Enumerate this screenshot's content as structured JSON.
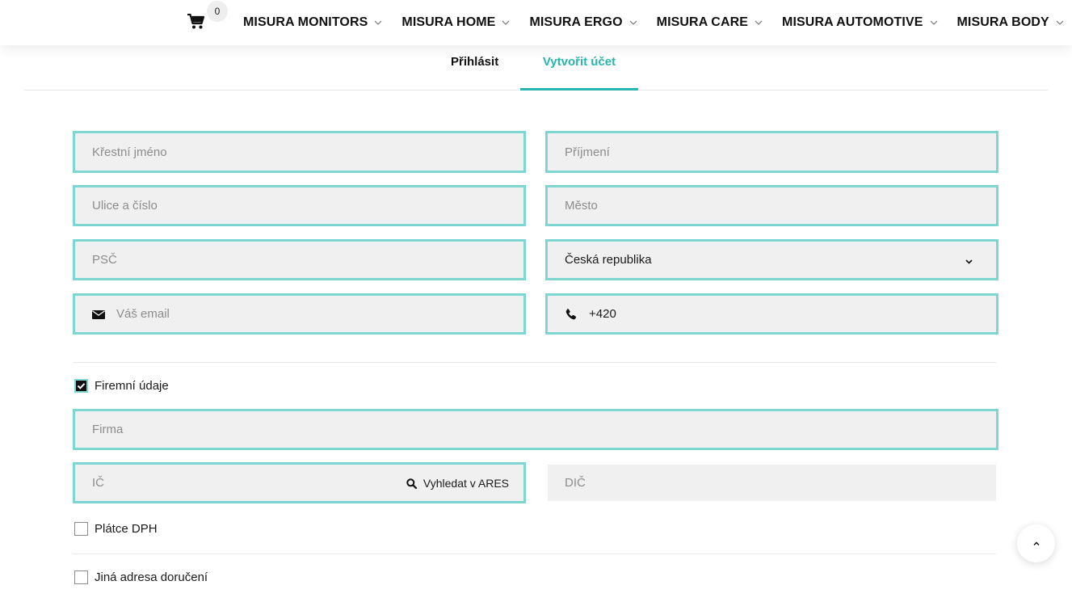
{
  "header": {
    "cart_count": "0",
    "nav": [
      {
        "label": "MISURA MONITORS"
      },
      {
        "label": "MISURA HOME"
      },
      {
        "label": "MISURA ERGO"
      },
      {
        "label": "MISURA CARE"
      },
      {
        "label": "MISURA AUTOMOTIVE"
      },
      {
        "label": "MISURA BODY"
      }
    ]
  },
  "tabs": {
    "login": "Přihlásit",
    "register": "Vytvořit účet",
    "active": "register"
  },
  "form": {
    "first_name": {
      "placeholder": "Křestní jméno",
      "value": ""
    },
    "last_name": {
      "placeholder": "Příjmení",
      "value": ""
    },
    "street": {
      "placeholder": "Ulice a číslo",
      "value": ""
    },
    "city": {
      "placeholder": "Město",
      "value": ""
    },
    "zip": {
      "placeholder": "PSČ",
      "value": ""
    },
    "country": {
      "selected": "Česká republika"
    },
    "email": {
      "placeholder": "Váš email",
      "value": ""
    },
    "phone": {
      "value": "+420"
    },
    "company_checkbox": {
      "label": "Firemní údaje",
      "checked": true
    },
    "company": {
      "placeholder": "Firma",
      "value": ""
    },
    "ic": {
      "placeholder": "IČ",
      "value": ""
    },
    "ares_button": {
      "label": "Vyhledat v ARES"
    },
    "dic": {
      "placeholder": "DIČ",
      "value": ""
    },
    "vat_payer": {
      "label": "Plátce DPH",
      "checked": false
    },
    "other_address": {
      "label": "Jiná adresa doručení",
      "checked": false
    }
  },
  "colors": {
    "accent": "#28b5b0",
    "field_border": "#7dd6d2",
    "field_bg": "#f0f0f0"
  }
}
